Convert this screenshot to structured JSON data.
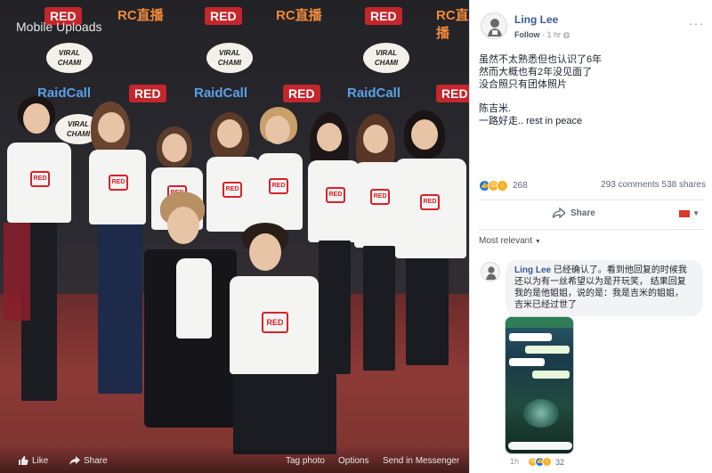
{
  "photo": {
    "album_label": "Mobile Uploads",
    "backdrop_logos": {
      "red": "RED",
      "rc": "RC直播",
      "raidcall": "RaidCall",
      "bubble": "VIRAL CHAMI"
    },
    "shirt_text": "RED",
    "toolbar": {
      "like": "Like",
      "share": "Share",
      "tag_photo": "Tag photo",
      "options": "Options",
      "send_messenger": "Send in Messenger"
    }
  },
  "post": {
    "author": "Ling Lee",
    "follow_label": "Follow",
    "time": "1 hr",
    "text_lines": [
      "虽然不太熟悉但也认识了6年",
      "然而大概也有2年没见面了",
      "没合照只有团体照片",
      "",
      "陈吉米.",
      "一路好走.. rest in peace"
    ],
    "reaction_count": "268",
    "comments": "293 comments",
    "shares": "538 shares",
    "share_label": "Share",
    "sort_label": "Most relevant"
  },
  "comment": {
    "author": "Ling Lee",
    "text_lines": [
      "已经确认了。看到他回复的时候我",
      "还以为有一丝希望以为是开玩笑， 结果回复",
      "我的是他姐姐，说的是：我是吉米的姐姐，",
      "吉米已经过世了"
    ],
    "time": "1h",
    "reaction_count": "32"
  },
  "colors": {
    "facebook_blue": "#385898",
    "red_brand": "#c4262b",
    "like_blue": "#1877f2",
    "sad_yellow": "#f7b125"
  }
}
